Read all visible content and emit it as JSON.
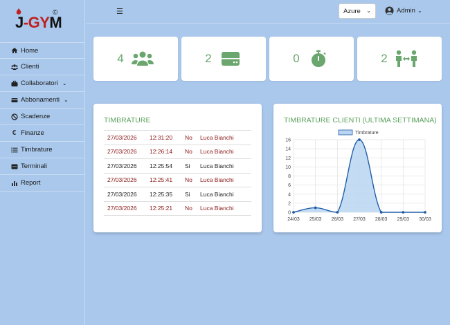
{
  "brand": {
    "logo_prefix": "J",
    "logo_sep": "-",
    "logo_red": "GY",
    "logo_suffix": "M",
    "copyright": "©"
  },
  "topbar": {
    "menu_icon": "bars-icon",
    "theme_value": "Azure",
    "user_label": "Admin"
  },
  "sidebar": {
    "items": [
      {
        "label": "Home",
        "icon": "home-icon"
      },
      {
        "label": "Clienti",
        "icon": "users-icon"
      },
      {
        "label": "Collaboratori",
        "icon": "briefcase-icon",
        "dropdown": true
      },
      {
        "label": "Abbonamenti",
        "icon": "ticket-icon",
        "dropdown": true
      },
      {
        "label": "Scadenze",
        "icon": "ban-icon"
      },
      {
        "label": "Finanze",
        "icon": "euro-icon"
      },
      {
        "label": "Timbrature",
        "icon": "list-icon"
      },
      {
        "label": "Terminali",
        "icon": "terminal-icon"
      },
      {
        "label": "Report",
        "icon": "chart-icon"
      }
    ]
  },
  "stats": [
    {
      "value": "4",
      "icon": "users-icon"
    },
    {
      "value": "2",
      "icon": "server-icon"
    },
    {
      "value": "0",
      "icon": "stopwatch-icon"
    },
    {
      "value": "2",
      "icon": "people-arrows-icon"
    }
  ],
  "timbrature": {
    "title": "TIMBRATURE",
    "rows": [
      {
        "date": "27/03/2026",
        "time": "12:31:20",
        "flag": "No",
        "name": "Luca Bianchi",
        "status": "no"
      },
      {
        "date": "27/03/2026",
        "time": "12:26:14",
        "flag": "No",
        "name": "Luca Bianchi",
        "status": "no"
      },
      {
        "date": "27/03/2026",
        "time": "12:25:54",
        "flag": "Si",
        "name": "Luca Bianchi",
        "status": "si"
      },
      {
        "date": "27/03/2026",
        "time": "12:25:41",
        "flag": "No",
        "name": "Luca Bianchi",
        "status": "no"
      },
      {
        "date": "27/03/2026",
        "time": "12:25:35",
        "flag": "Si",
        "name": "Luca Bianchi",
        "status": "si"
      },
      {
        "date": "27/03/2026",
        "time": "12:25:21",
        "flag": "No",
        "name": "Luca Bianchi",
        "status": "no"
      }
    ]
  },
  "chart_panel": {
    "title": "TIMBRATURE CLIENTI (ULTIMA SETTIMANA)"
  },
  "chart_data": {
    "type": "area",
    "categories": [
      "24/03",
      "25/03",
      "26/03",
      "27/03",
      "28/03",
      "29/03",
      "30/03"
    ],
    "series": [
      {
        "name": "Timbrature",
        "values": [
          0,
          1,
          0,
          16,
          0,
          0,
          0
        ]
      }
    ],
    "ylim": [
      0,
      16
    ],
    "yticks": [
      0,
      2,
      4,
      6,
      8,
      10,
      12,
      14,
      16
    ],
    "grid": true,
    "legend": "top",
    "colors": {
      "line": "#1f5fa8",
      "fill": "#b9d5f1",
      "point": "#1f5fa8"
    }
  }
}
